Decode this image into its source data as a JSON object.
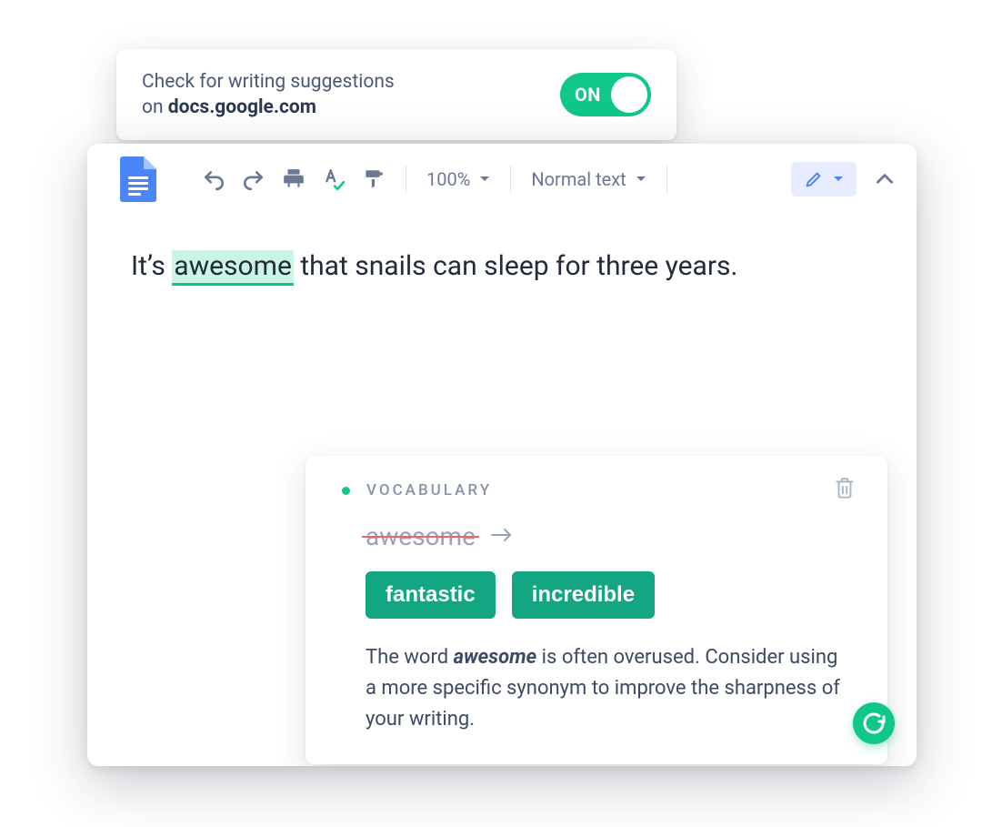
{
  "extension": {
    "line1": "Check for writing suggestions",
    "line2_prefix": "on ",
    "domain": "docs.google.com",
    "toggle_state": "ON"
  },
  "toolbar": {
    "zoom": "100%",
    "style": "Normal text",
    "icons": {
      "undo": "undo-icon",
      "redo": "redo-icon",
      "print": "print-icon",
      "spellcheck": "spellcheck-icon",
      "paintformat": "paint-format-icon",
      "editmode": "edit-mode-icon",
      "collapse": "collapse-icon"
    }
  },
  "document": {
    "text_before": "It’s ",
    "highlighted_word": "awesome",
    "text_after": " that snails can sleep for three years."
  },
  "suggestion": {
    "category": "VOCABULARY",
    "original_word": "awesome",
    "replacements": [
      "fantastic",
      "incredible"
    ],
    "explanation_pre": "The word ",
    "explanation_word": "awesome",
    "explanation_post": " is often overused. Consider using a more specific synonym to improve the sharpness of your writing."
  }
}
